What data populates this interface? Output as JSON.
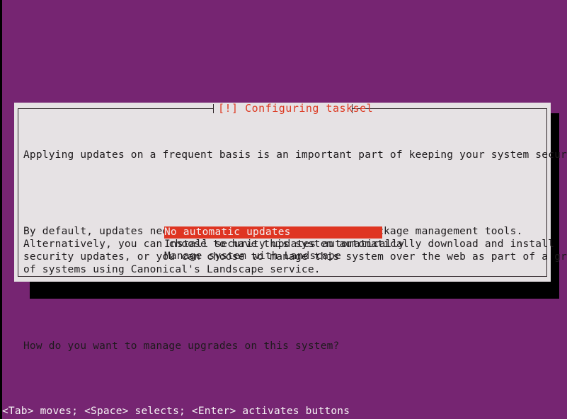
{
  "screen": {
    "background_color": "#762572",
    "shadow_color": "#000000"
  },
  "dialog": {
    "title": "[!] Configuring tasksel",
    "title_color": "#dd3b24",
    "background_color": "#e6e2e4",
    "border_color": "#2b2226",
    "paragraphs": [
      "Applying updates on a frequent basis is an important part of keeping your system secure.",
      "By default, updates need to be applied manually using package management tools.\nAlternatively, you can choose to have this system automatically download and install\nsecurity updates, or you can choose to manage this system over the web as part of a group\nof systems using Canonical's Landscape service.",
      "How do you want to manage upgrades on this system?"
    ]
  },
  "choices": {
    "selected_index": 0,
    "highlight_color": "#df3522",
    "highlight_text_color": "#f2eef0",
    "items": [
      "No automatic updates",
      "Install security updates automatically",
      "Manage system with Landscape"
    ]
  },
  "help_bar": {
    "text": "<Tab> moves; <Space> selects; <Enter> activates buttons"
  }
}
